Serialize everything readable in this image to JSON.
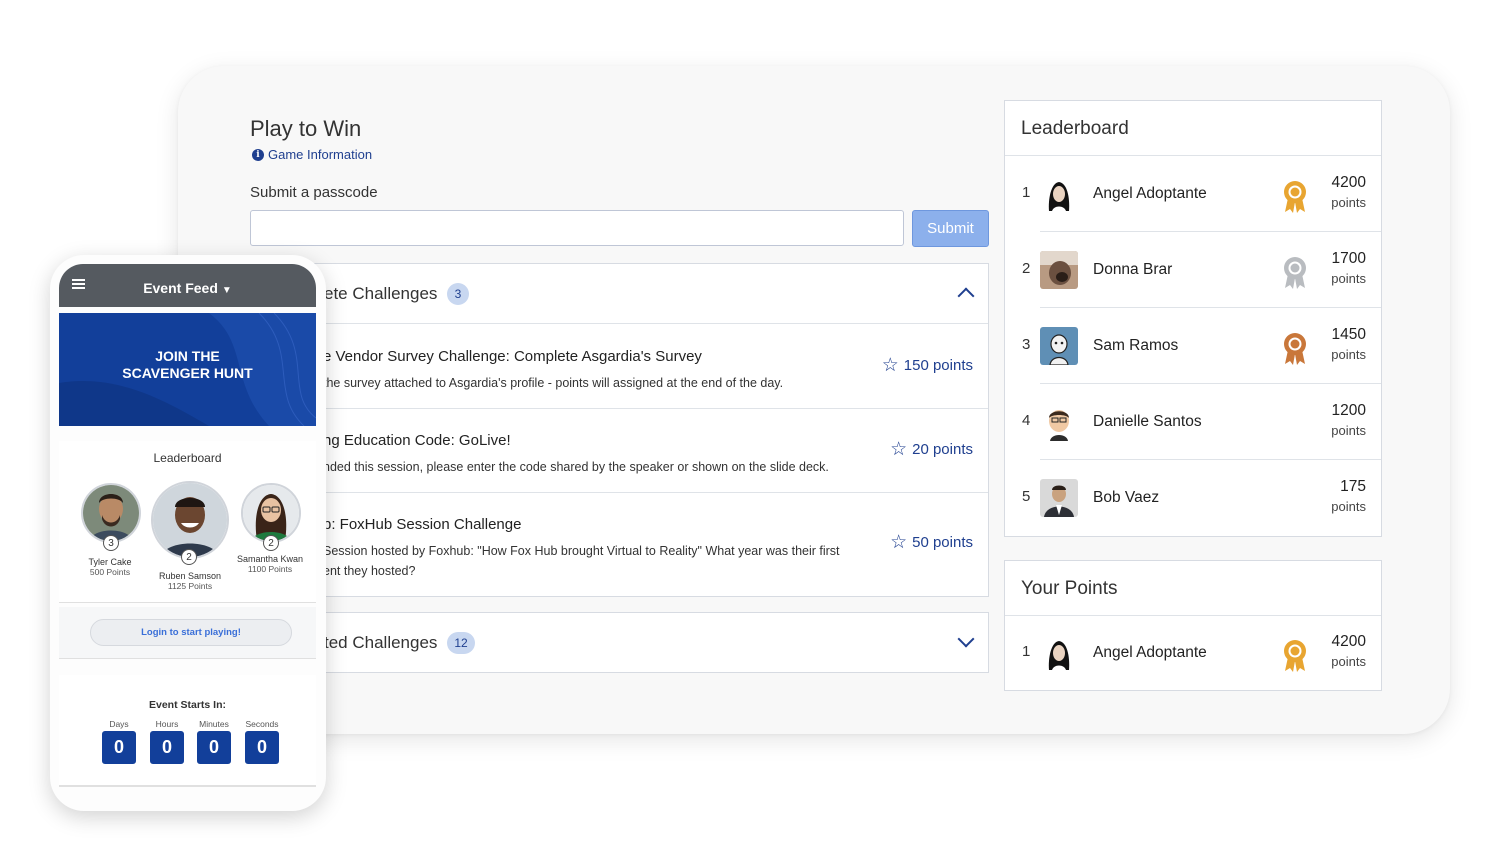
{
  "game": {
    "title": "Play to Win",
    "info_link": "Game Information",
    "passcode_label": "Submit a passcode",
    "passcode_value": "",
    "submit_label": "Submit"
  },
  "challenges": {
    "open": {
      "title": "ete Challenges",
      "count": "3",
      "items": [
        {
          "title": "e Vendor Survey Challenge: Complete Asgardia's Survey",
          "desc": "the survey attached to Asgardia's profile - points will assigned at the end of the day.",
          "desc2": "",
          "points": "150 points"
        },
        {
          "title": "ng Education Code: GoLive!",
          "desc": "nded this session, please enter the code shared by the speaker or shown on the slide deck.",
          "desc2": "",
          "points": "20 points"
        },
        {
          "title": "b: FoxHub Session Challenge",
          "desc": "Session hosted by Foxhub: \"How Fox Hub brought Virtual to Reality\" What year was their first",
          "desc2": "ent they hosted?",
          "points": "50 points"
        }
      ]
    },
    "closed": {
      "title": "ted Challenges",
      "count": "12"
    }
  },
  "leaderboard": {
    "title": "Leaderboard",
    "points_word": "points",
    "rows": [
      {
        "rank": "1",
        "name": "Angel Adoptante",
        "points": "4200",
        "medal": "gold"
      },
      {
        "rank": "2",
        "name": "Donna Brar",
        "points": "1700",
        "medal": "silver"
      },
      {
        "rank": "3",
        "name": "Sam Ramos",
        "points": "1450",
        "medal": "bronze"
      },
      {
        "rank": "4",
        "name": "Danielle Santos",
        "points": "1200",
        "medal": ""
      },
      {
        "rank": "5",
        "name": "Bob Vaez",
        "points": "175",
        "medal": ""
      }
    ]
  },
  "your_points": {
    "title": "Your Points",
    "rank": "1",
    "name": "Angel Adoptante",
    "points": "4200",
    "points_word": "points"
  },
  "phone": {
    "feed_title": "Event Feed",
    "hero_line1": "JOIN THE",
    "hero_line2": "SCAVENGER HUNT",
    "leaderboard_title": "Leaderboard",
    "podium": [
      {
        "rank": "3",
        "name": "Tyler Cake",
        "points": "500 Points"
      },
      {
        "rank": "2",
        "name": "Ruben Samson",
        "points": "1125 Points"
      },
      {
        "rank": "2",
        "name": "Samantha Kwan",
        "points": "1100 Points"
      }
    ],
    "login_label": "Login to start playing!",
    "starts_label": "Event Starts In:",
    "countdown": [
      {
        "label": "Days",
        "value": "0"
      },
      {
        "label": "Hours",
        "value": "0"
      },
      {
        "label": "Minutes",
        "value": "0"
      },
      {
        "label": "Seconds",
        "value": "0"
      }
    ]
  },
  "colors": {
    "brand_blue": "#123f9a",
    "link_blue": "#1f3f8f",
    "submit_bg": "#8cb0ec",
    "gold": "#e8a531",
    "silver": "#b9bcc0",
    "bronze": "#c9773a"
  }
}
